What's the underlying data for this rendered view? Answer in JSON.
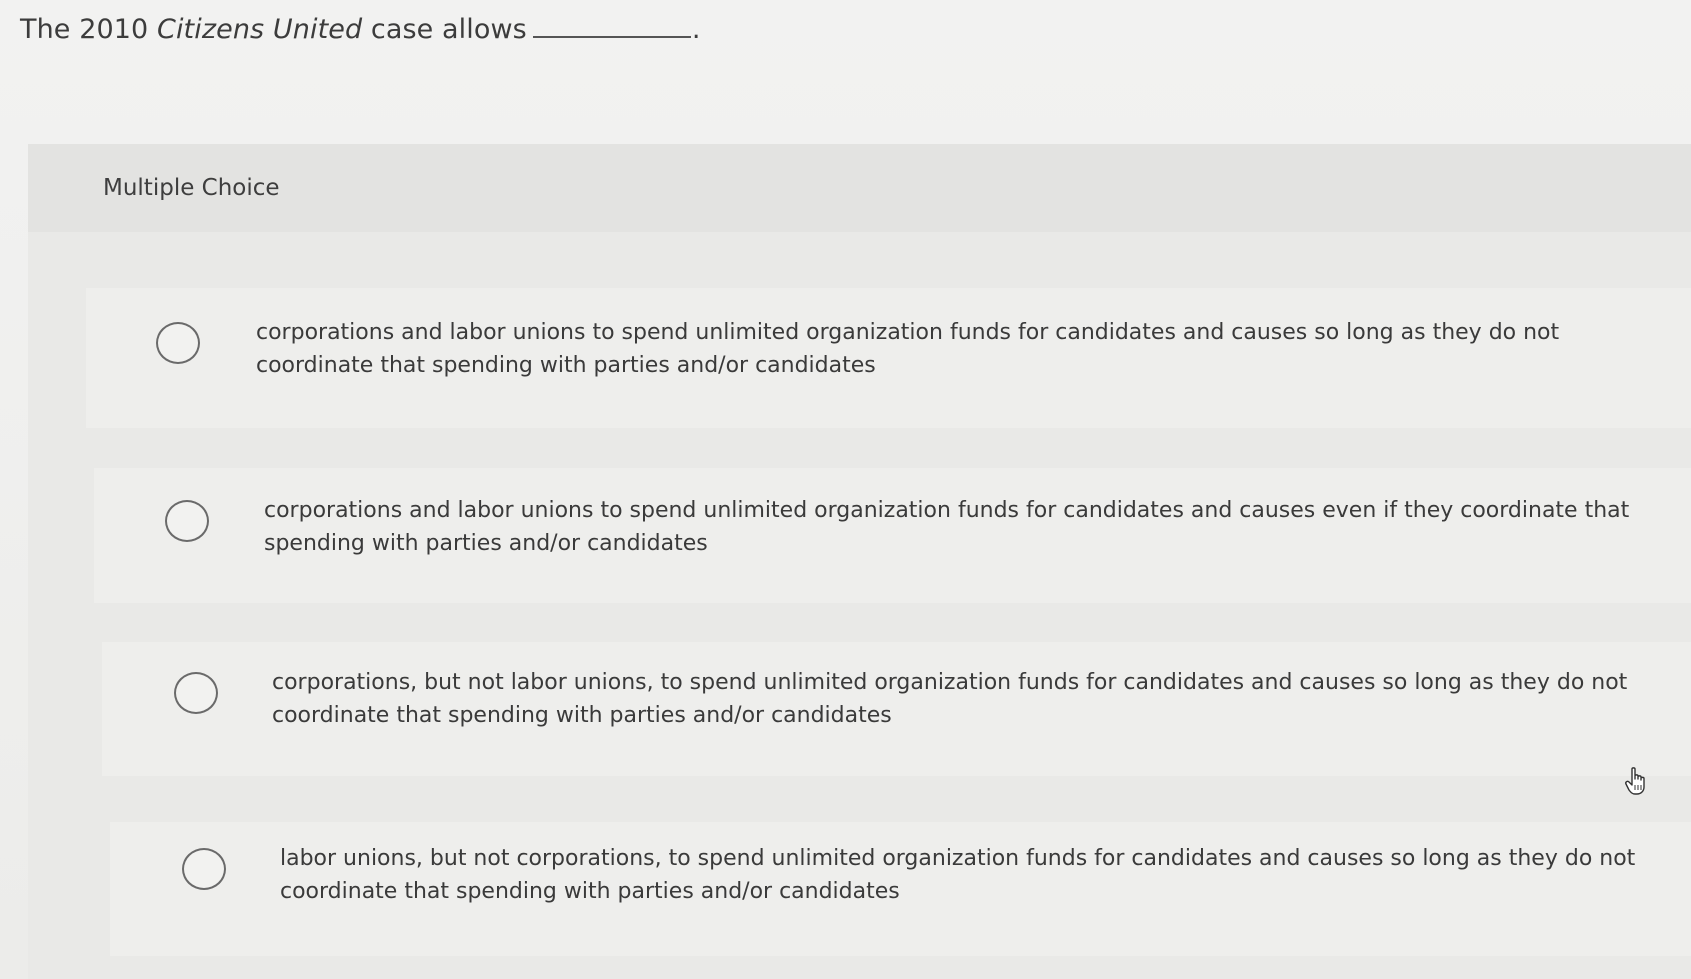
{
  "question": {
    "prefix": "The 2010 ",
    "case_name": "Citizens United",
    "suffix": " case allows",
    "period": "."
  },
  "panel": {
    "header_label": "Multiple Choice"
  },
  "choices": [
    {
      "text": "corporations and labor unions to spend unlimited organization funds for candidates and causes so long as they do not coordinate that spending with parties and/or candidates"
    },
    {
      "text": "corporations and labor unions to spend unlimited organization funds for candidates and causes even if they coordinate that spending with parties and/or candidates"
    },
    {
      "text": "corporations, but not labor unions, to spend unlimited organization funds for candidates and causes so long as they do not coordinate that spending with parties and/or candidates"
    },
    {
      "text": "labor unions, but not corporations, to spend unlimited organization funds for candidates and causes so long as they do not coordinate that spending with parties and/or candidates"
    }
  ],
  "icons": {
    "radio": "radio-button-unselected-icon",
    "cursor": "hand-pointer-cursor-icon"
  }
}
